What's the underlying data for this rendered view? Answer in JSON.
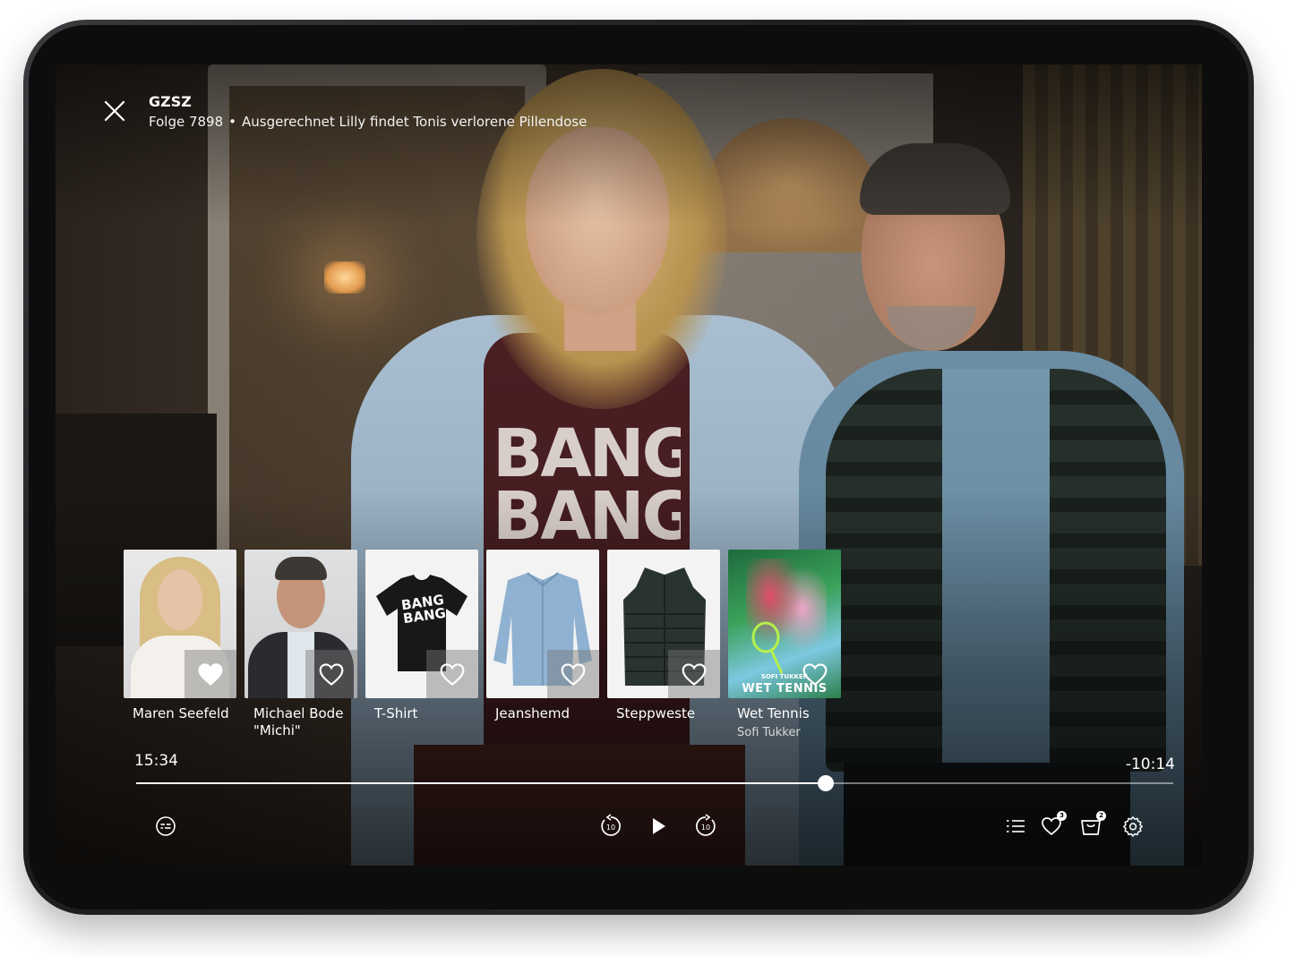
{
  "header": {
    "show_title": "GZSZ",
    "episode": "Folge 7898",
    "separator": "•",
    "episode_title": "Ausgerechnet Lilly findet Tonis verlorene Pillendose"
  },
  "cards": [
    {
      "label": "Maren Seefeld",
      "sublabel": "",
      "kind": "person",
      "favorited": true
    },
    {
      "label": "Michael Bode \"Michi\"",
      "sublabel": "",
      "kind": "person",
      "favorited": false
    },
    {
      "label": "T-Shirt",
      "sublabel": "",
      "kind": "product",
      "favorited": false
    },
    {
      "label": "Jeanshemd",
      "sublabel": "",
      "kind": "product",
      "favorited": false
    },
    {
      "label": "Steppweste",
      "sublabel": "",
      "kind": "product",
      "favorited": false
    },
    {
      "label": "Wet Tennis",
      "sublabel": "Sofi Tukker",
      "kind": "music",
      "favorited": false
    }
  ],
  "tshirt_print": "BANG BANG",
  "album_cover": {
    "artist": "SOFI TUKKER",
    "title": "WET TENNIS"
  },
  "player": {
    "elapsed": "15:34",
    "remaining": "-10:14",
    "progress": 0.665
  },
  "badges": {
    "favorites": "3",
    "cart": "2"
  },
  "icons": {
    "close": "close-icon",
    "subtitles": "subtitles-icon",
    "rewind": "rewind-10-icon",
    "play": "play-icon",
    "forward": "forward-10-icon",
    "chapters": "list-icon",
    "favorites": "heart-icon",
    "cart": "cart-icon",
    "settings": "gear-icon"
  },
  "colors": {
    "text": "#ffffff",
    "track": "#ffffff"
  }
}
